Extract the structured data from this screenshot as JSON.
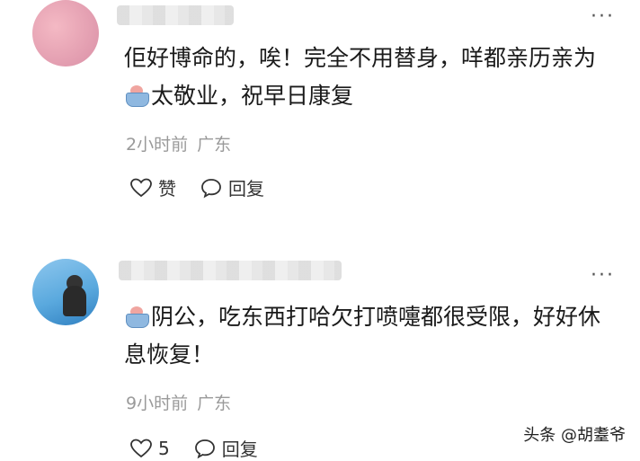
{
  "comments": [
    {
      "text_a": "佢好博命的，唉！完全不用替身，咩都亲历亲为",
      "text_b": "太敬业，祝早日康复",
      "time": "2小时前",
      "region": "广东",
      "like_label": "赞",
      "reply_label": "回复"
    },
    {
      "text_b": "阴公，吃东西打哈欠打喷嚏都很受限，好好休息恢复！",
      "time": "9小时前",
      "region": "广东",
      "like_label": "5",
      "reply_label": "回复"
    }
  ],
  "more_glyph": "···",
  "watermark": "头条 @胡耋爷",
  "icons": {
    "like": "heart-outline-icon",
    "reply": "speech-bubble-icon",
    "emoji": "bath-emoji-icon",
    "more": "more-dots-icon"
  }
}
